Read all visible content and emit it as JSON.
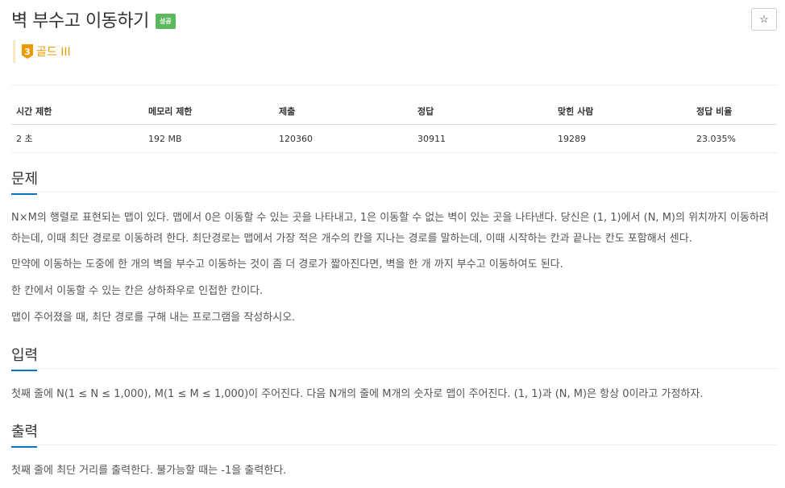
{
  "problem": {
    "title": "벽 부수고 이동하기",
    "status_badge": "성공",
    "star_icon": "☆",
    "tier_number": "3",
    "tier_label": "골드 III"
  },
  "stats": {
    "headers": [
      "시간 제한",
      "메모리 제한",
      "제출",
      "정답",
      "맞힌 사람",
      "정답 비율"
    ],
    "values": [
      "2 초",
      "192 MB",
      "120360",
      "30911",
      "19289",
      "23.035%"
    ]
  },
  "sections": {
    "problem_heading": "문제",
    "problem_paragraphs": [
      "N×M의 행렬로 표현되는 맵이 있다. 맵에서 0은 이동할 수 있는 곳을 나타내고, 1은 이동할 수 없는 벽이 있는 곳을 나타낸다. 당신은 (1, 1)에서 (N, M)의 위치까지 이동하려 하는데, 이때 최단 경로로 이동하려 한다. 최단경로는 맵에서 가장 적은 개수의 칸을 지나는 경로를 말하는데, 이때 시작하는 칸과 끝나는 칸도 포함해서 센다.",
      "만약에 이동하는 도중에 한 개의 벽을 부수고 이동하는 것이 좀 더 경로가 짧아진다면, 벽을 한 개 까지 부수고 이동하여도 된다.",
      "한 칸에서 이동할 수 있는 칸은 상하좌우로 인접한 칸이다.",
      "맵이 주어졌을 때, 최단 경로를 구해 내는 프로그램을 작성하시오."
    ],
    "input_heading": "입력",
    "input_text": "첫째 줄에 N(1 ≤ N ≤ 1,000), M(1 ≤ M ≤ 1,000)이 주어진다. 다음 N개의 줄에 M개의 숫자로 맵이 주어진다. (1, 1)과 (N, M)은 항상 0이라고 가정하자.",
    "output_heading": "출력",
    "output_text": "첫째 줄에 최단 거리를 출력한다. 불가능할 때는 -1을 출력한다."
  },
  "colors": {
    "accent": "#0076c0",
    "success": "#5cb85c",
    "gold_tier": "#ec9a00"
  }
}
